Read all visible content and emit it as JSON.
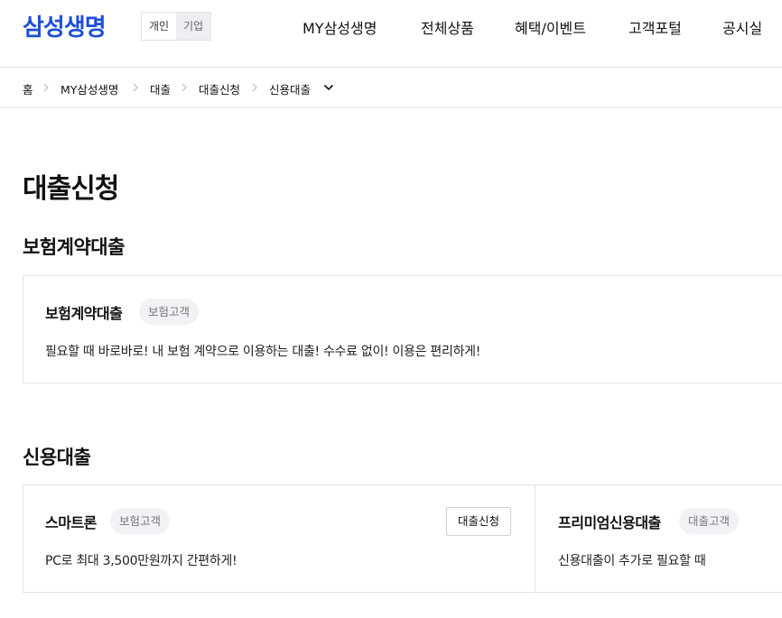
{
  "header": {
    "logo": "삼성생명",
    "segments": [
      "개인",
      "기업"
    ],
    "nav": [
      "MY삼성생명",
      "전체상품",
      "혜택/이벤트",
      "고객포털",
      "공시실"
    ]
  },
  "breadcrumb": [
    "홈",
    "MY삼성생명",
    "대출",
    "대출신청",
    "신용대출"
  ],
  "page_title": "대출신청",
  "sections": [
    {
      "title": "보험계약대출",
      "cards": [
        {
          "name": "보험계약대출",
          "badge": "보험고객",
          "desc": "필요할 때 바로바로! 내 보험 계약으로 이용하는 대출! 수수료 없이! 이용은 편리하게!"
        }
      ]
    },
    {
      "title": "신용대출",
      "cards": [
        {
          "name": "스마트론",
          "badge": "보험고객",
          "desc": "PC로 최대 3,500만원까지 간편하게!",
          "button": "대출신청"
        },
        {
          "name": "프리미엄신용대출",
          "badge": "대출고객",
          "desc": "신용대출이 추가로 필요할 때"
        }
      ]
    }
  ],
  "colors": {
    "brand": "#1d4fd8",
    "badge_bg": "#f0f2f5",
    "border": "#e3e3e3"
  }
}
